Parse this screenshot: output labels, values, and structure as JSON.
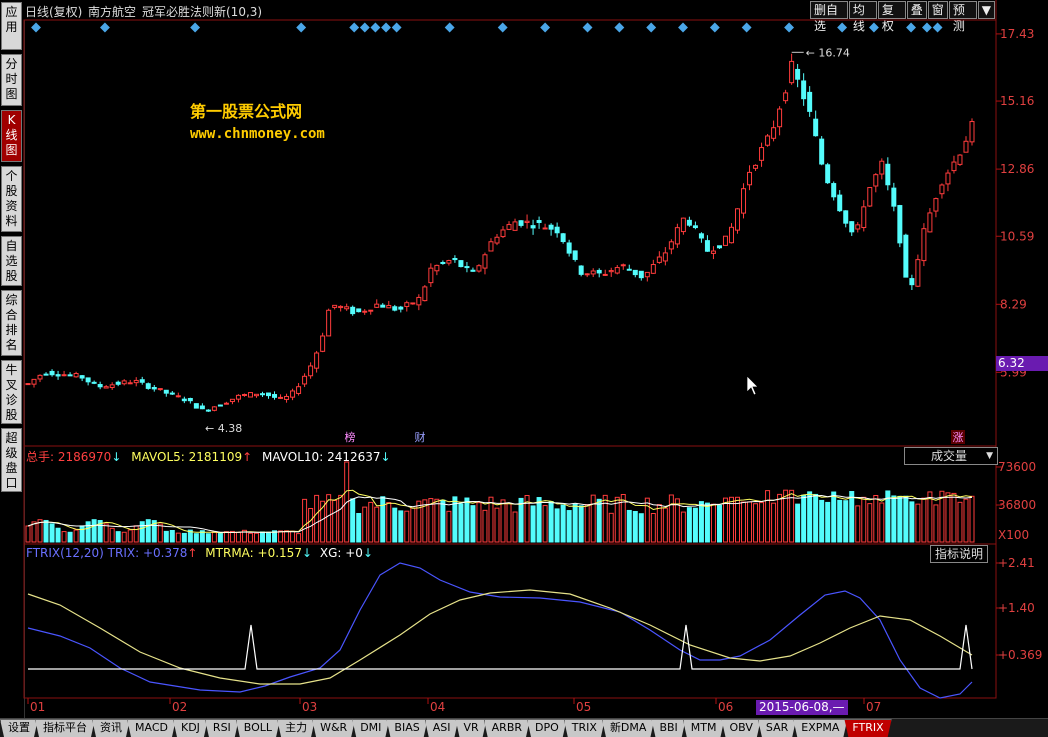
{
  "leftnav": [
    {
      "label": "应用",
      "active": false
    },
    {
      "label": "分时图",
      "active": false
    },
    {
      "label": "K线图",
      "active": true
    },
    {
      "label": "个股资料",
      "active": false
    },
    {
      "label": "自选股",
      "active": false
    },
    {
      "label": "综合排名",
      "active": false
    },
    {
      "label": "牛叉诊股",
      "active": false
    },
    {
      "label": "超级盘口",
      "active": false
    }
  ],
  "header": {
    "period": "日线(复权)",
    "stock": "南方航空",
    "formula": "冠军必胜法则新(10,3)"
  },
  "toolbar": {
    "buttons": [
      "删自选",
      "均线",
      "复权",
      "叠",
      "窗",
      "预测"
    ],
    "menu_icon": "triangle-down-icon"
  },
  "watermark": {
    "line1": "第一股票公式网",
    "line2": "www.chnmoney.com"
  },
  "price_axis": {
    "labels": [
      "17.43",
      "15.16",
      "12.86",
      "10.59",
      "8.29",
      "5.99"
    ],
    "current_price": "6.32",
    "high_marker": "16.74",
    "low_marker": "4.38"
  },
  "event_markers": [
    "榜",
    "财",
    "涨"
  ],
  "volume": {
    "total_label": "总手:",
    "total_value": "2186970",
    "mavol5_label": "MAVOL5:",
    "mavol5_value": "2181109",
    "mavol10_label": "MAVOL10:",
    "mavol10_value": "2412637",
    "selector": "成交量",
    "axis": [
      "73600",
      "36800"
    ],
    "unit": "X100"
  },
  "indicator": {
    "name": "FTRIX(12,20)",
    "trix_label": "TRIX:",
    "trix_value": "+0.378",
    "mtrma_label": "MTRMA:",
    "mtrma_value": "+0.157",
    "xg_label": "XG:",
    "xg_value": "+0",
    "explain_button": "指标说明",
    "axis": [
      "+2.41",
      "+1.40",
      "+0.369"
    ]
  },
  "date_axis": {
    "months": [
      "01",
      "02",
      "03",
      "04",
      "05",
      "06",
      "07"
    ],
    "cursor_date": "2015-06-08,—"
  },
  "tabs": [
    "设置",
    "指标平台",
    "资讯",
    "MACD",
    "KDJ",
    "RSI",
    "BOLL",
    "主力",
    "W&R",
    "DMI",
    "BIAS",
    "ASI",
    "VR",
    "ARBR",
    "DPO",
    "TRIX",
    "新DMA",
    "BBI",
    "MTM",
    "OBV",
    "SAR",
    "EXPMA",
    "FTRIX"
  ],
  "active_tab": "FTRIX",
  "colors": {
    "up": "#ff3c3c",
    "down": "#54fcfc",
    "trix_line": "#4a55ff",
    "mtrma_line": "#e6e28a",
    "xg_line": "#ffffff",
    "axis_red": "#b01010",
    "current_price_bg": "#6a1bb0"
  }
}
